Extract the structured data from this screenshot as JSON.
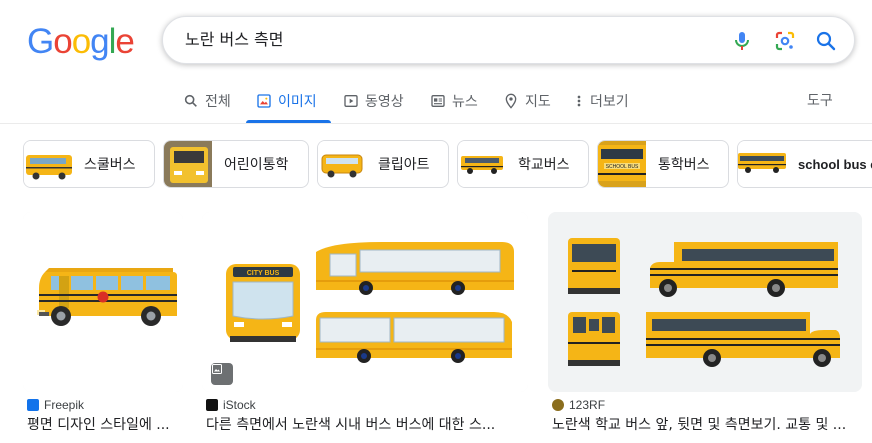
{
  "logo": {
    "letters": [
      "G",
      "o",
      "o",
      "g",
      "l",
      "e"
    ],
    "colors": [
      "#4285f4",
      "#ea4335",
      "#fbbc05",
      "#4285f4",
      "#34a853",
      "#ea4335"
    ]
  },
  "search": {
    "query": "노란 버스 측면"
  },
  "tabs": [
    {
      "label": "전체",
      "icon": "search-icon"
    },
    {
      "label": "이미지",
      "icon": "image-icon",
      "active": true
    },
    {
      "label": "동영상",
      "icon": "play-icon"
    },
    {
      "label": "뉴스",
      "icon": "news-icon"
    },
    {
      "label": "지도",
      "icon": "map-pin-icon"
    },
    {
      "label": "더보기",
      "icon": "more-vert-icon"
    }
  ],
  "tools_label": "도구",
  "chips": [
    {
      "label": "스쿨버스"
    },
    {
      "label": "어린이통학"
    },
    {
      "label": "클립아트"
    },
    {
      "label": "학교버스"
    },
    {
      "label": "통학버스"
    },
    {
      "label": "school bus e"
    }
  ],
  "results": [
    {
      "source": "Freepik",
      "caption": "평면 디자인 스타일에 ..."
    },
    {
      "source": "iStock",
      "caption": "다른 측면에서 노란색 시내 버스 버스에 대한 스..."
    },
    {
      "source": "123RF",
      "caption": "노란색 학교 버스 앞, 뒷면 및 측면보기. 교통 및 ..."
    }
  ],
  "image_text": {
    "city_bus": "CITY BUS",
    "school_bus": "SCHOOL BUS"
  },
  "colors": {
    "accent": "#1a73e8",
    "bus_yellow": "#f5b516",
    "bus_dark": "#2a2a2a"
  }
}
